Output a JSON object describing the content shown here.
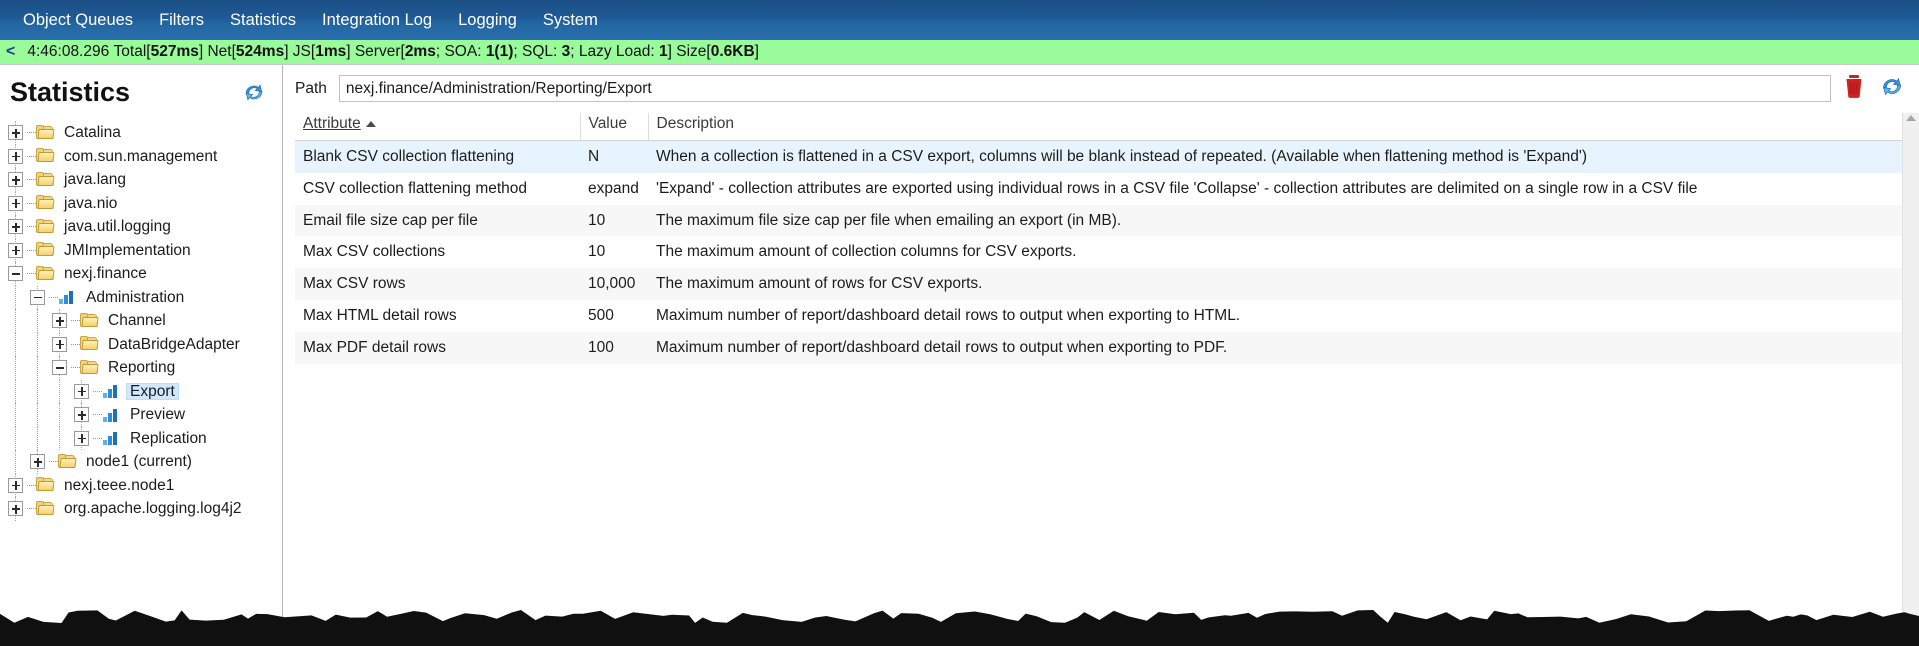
{
  "menu": {
    "items": [
      {
        "label": "Object Queues"
      },
      {
        "label": "Filters"
      },
      {
        "label": "Statistics"
      },
      {
        "label": "Integration Log"
      },
      {
        "label": "Logging"
      },
      {
        "label": "System"
      }
    ]
  },
  "statusbar": {
    "back_arrow": "<",
    "timestamp": "4:46:08.296",
    "total_label": "Total[",
    "total_value": "527ms",
    "net_label": "] Net[",
    "net_value": "524ms",
    "js_label": "] JS[",
    "js_value": "1ms",
    "server_label": "] Server[",
    "server_value": "2ms",
    "soa_label": "; SOA: ",
    "soa_value": "1(1)",
    "sql_label": "; SQL: ",
    "sql_value": "3",
    "lazy_label": "; Lazy Load: ",
    "lazy_value": "1",
    "size_label": "] Size[",
    "size_value": "0.6KB",
    "size_close": "]",
    "background_color": "#99fb99"
  },
  "sidebar": {
    "title": "Statistics",
    "refresh_icon": "refresh-icon",
    "tree": [
      {
        "label": "Catalina",
        "depth": 0,
        "icon": "folder-icon",
        "expander": "plus",
        "selected": false
      },
      {
        "label": "com.sun.management",
        "depth": 0,
        "icon": "folder-icon",
        "expander": "plus",
        "selected": false
      },
      {
        "label": "java.lang",
        "depth": 0,
        "icon": "folder-icon",
        "expander": "plus",
        "selected": false
      },
      {
        "label": "java.nio",
        "depth": 0,
        "icon": "folder-icon",
        "expander": "plus",
        "selected": false
      },
      {
        "label": "java.util.logging",
        "depth": 0,
        "icon": "folder-icon",
        "expander": "plus",
        "selected": false
      },
      {
        "label": "JMImplementation",
        "depth": 0,
        "icon": "folder-icon",
        "expander": "plus",
        "selected": false
      },
      {
        "label": "nexj.finance",
        "depth": 0,
        "icon": "folder-icon",
        "expander": "minus",
        "selected": false
      },
      {
        "label": "Administration",
        "depth": 1,
        "icon": "bars-icon",
        "expander": "minus",
        "selected": false
      },
      {
        "label": "Channel",
        "depth": 2,
        "icon": "folder-icon",
        "expander": "plus",
        "selected": false
      },
      {
        "label": "DataBridgeAdapter",
        "depth": 2,
        "icon": "folder-icon",
        "expander": "plus",
        "selected": false
      },
      {
        "label": "Reporting",
        "depth": 2,
        "icon": "folder-icon",
        "expander": "minus",
        "selected": false
      },
      {
        "label": "Export",
        "depth": 3,
        "icon": "bars-icon",
        "expander": "plus",
        "selected": true
      },
      {
        "label": "Preview",
        "depth": 3,
        "icon": "bars-icon",
        "expander": "plus",
        "selected": false
      },
      {
        "label": "Replication",
        "depth": 3,
        "icon": "bars-icon",
        "expander": "plus",
        "selected": false
      },
      {
        "label": "node1 (current)",
        "depth": 1,
        "icon": "folder-icon",
        "expander": "plus",
        "selected": false
      },
      {
        "label": "nexj.teee.node1",
        "depth": 0,
        "icon": "folder-icon",
        "expander": "plus",
        "selected": false
      },
      {
        "label": "org.apache.logging.log4j2",
        "depth": 0,
        "icon": "folder-icon",
        "expander": "plus",
        "selected": false
      }
    ]
  },
  "toolbar": {
    "path_label": "Path",
    "path_value": "nexj.finance/Administration/Reporting/Export",
    "path_placeholder": "",
    "delete_icon": "trash-icon",
    "refresh_icon": "refresh-icon"
  },
  "table": {
    "columns": [
      {
        "label": "Attribute",
        "sorted": "asc"
      },
      {
        "label": "Value",
        "sorted": ""
      },
      {
        "label": "Description",
        "sorted": ""
      }
    ],
    "rows": [
      {
        "attribute": "Blank CSV collection flattening",
        "value": "N",
        "description": "When a collection is flattened in a CSV export, columns will be blank instead of repeated. (Available when flattening method is 'Expand')"
      },
      {
        "attribute": "CSV collection flattening method",
        "value": "expand",
        "description": "'Expand' - collection attributes are exported using individual rows in a CSV file    'Collapse' - collection attributes are delimited on a single row in a CSV file"
      },
      {
        "attribute": "Email file size cap per file",
        "value": "10",
        "description": "The maximum file size cap per file when emailing an export (in MB)."
      },
      {
        "attribute": "Max CSV collections",
        "value": "10",
        "description": "The maximum amount of collection columns for CSV exports."
      },
      {
        "attribute": "Max CSV rows",
        "value": "10,000",
        "description": "The maximum amount of rows for CSV exports."
      },
      {
        "attribute": "Max HTML detail rows",
        "value": "500",
        "description": "Maximum number of report/dashboard detail rows to output when exporting to HTML."
      },
      {
        "attribute": "Max PDF detail rows",
        "value": "100",
        "description": "Maximum number of report/dashboard detail rows to output when exporting to PDF."
      }
    ],
    "scrollbar": {
      "up_arrow": "scroll-up-arrow",
      "down_arrow": "scroll-down-arrow"
    }
  },
  "colors": {
    "menu_blue": "#1f5a96",
    "status_green": "#99fb99",
    "row_highlight": "#e8f4fd",
    "selection_blue": "#cfe8fb",
    "trash_red": "#cc2222",
    "refresh_blue": "#3a8fd8"
  }
}
